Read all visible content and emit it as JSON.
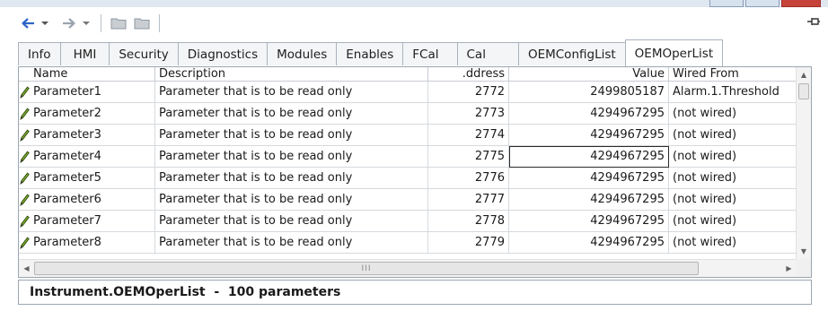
{
  "colors": {
    "accent": "#2e66c8",
    "selection_outline": "#2a2a2a",
    "pencil": "#6a9a1f"
  },
  "toolbar": {
    "icons": [
      "back-arrow-icon",
      "dropdown-icon",
      "forward-arrow-icon",
      "dropdown-icon",
      "folder-icon",
      "folder-icon"
    ],
    "pin_icon": "pin-icon"
  },
  "tabs": [
    {
      "label": "Info",
      "active": false
    },
    {
      "label": "HMI",
      "active": false
    },
    {
      "label": "Security",
      "active": false
    },
    {
      "label": "Diagnostics",
      "active": false
    },
    {
      "label": "Modules",
      "active": false
    },
    {
      "label": "Enables",
      "active": false
    },
    {
      "label": "FCal",
      "active": false
    },
    {
      "label": "Cal",
      "active": false
    },
    {
      "label": "OEMConfigList",
      "active": false
    },
    {
      "label": "OEMOperList",
      "active": true
    }
  ],
  "grid": {
    "columns": {
      "name": "Name",
      "description": "Description",
      "address": ".ddress",
      "value": "Value",
      "wired_from": "Wired From"
    },
    "rows": [
      {
        "name": "Parameter1",
        "description": "Parameter that is to be read only",
        "address": "2772",
        "value": "2499805187",
        "wired_from": "Alarm.1.Threshold"
      },
      {
        "name": "Parameter2",
        "description": "Parameter that is to be read only",
        "address": "2773",
        "value": "4294967295",
        "wired_from": "(not wired)"
      },
      {
        "name": "Parameter3",
        "description": "Parameter that is to be read only",
        "address": "2774",
        "value": "4294967295",
        "wired_from": "(not wired)"
      },
      {
        "name": "Parameter4",
        "description": "Parameter that is to be read only",
        "address": "2775",
        "value": "4294967295",
        "wired_from": "(not wired)"
      },
      {
        "name": "Parameter5",
        "description": "Parameter that is to be read only",
        "address": "2776",
        "value": "4294967295",
        "wired_from": "(not wired)"
      },
      {
        "name": "Parameter6",
        "description": "Parameter that is to be read only",
        "address": "2777",
        "value": "4294967295",
        "wired_from": "(not wired)"
      },
      {
        "name": "Parameter7",
        "description": "Parameter that is to be read only",
        "address": "2778",
        "value": "4294967295",
        "wired_from": "(not wired)"
      },
      {
        "name": "Parameter8",
        "description": "Parameter that is to be read only",
        "address": "2779",
        "value": "4294967295",
        "wired_from": "(not wired)"
      }
    ],
    "scroll_thumb_label": "III"
  },
  "status": {
    "text": "Instrument.OEMOperList  -  100 parameters"
  }
}
